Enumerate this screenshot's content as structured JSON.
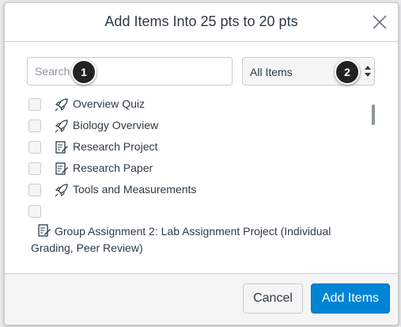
{
  "dialog": {
    "title": "Add Items Into 25 pts to 20 pts"
  },
  "search": {
    "placeholder": "Search",
    "value": ""
  },
  "filter": {
    "selected": "All Items"
  },
  "callouts": [
    "1",
    "2"
  ],
  "items": [
    {
      "label": "Overview Quiz",
      "icon": "quiz-rocket-icon"
    },
    {
      "label": "Biology Overview",
      "icon": "quiz-rocket-icon"
    },
    {
      "label": "Research Project",
      "icon": "assignment-icon"
    },
    {
      "label": "Research Paper",
      "icon": "assignment-icon"
    },
    {
      "label": "Tools and Measurements",
      "icon": "quiz-rocket-icon"
    },
    {
      "label": "Group Assignment 2: Lab Assignment Project (Individual Grading, Peer Review)",
      "icon": "assignment-icon"
    }
  ],
  "footer": {
    "cancel_label": "Cancel",
    "add_label": "Add Items"
  },
  "colors": {
    "primary_button": "#0084d4",
    "text": "#2d3b45",
    "border": "#c7cdd1"
  }
}
